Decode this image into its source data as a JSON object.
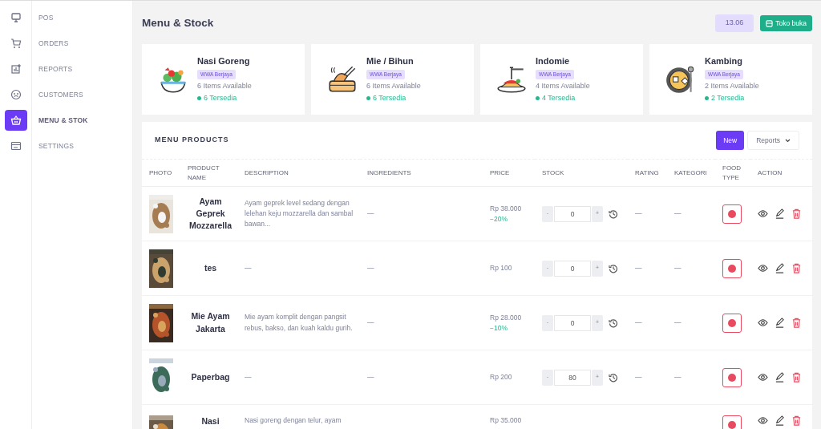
{
  "nav": [
    {
      "label": "POS",
      "selected": false
    },
    {
      "label": "ORDERS",
      "selected": false
    },
    {
      "label": "REPORTS",
      "selected": false
    },
    {
      "label": "CUSTOMERS",
      "selected": false
    },
    {
      "label": "MENU & STOK",
      "selected": true
    },
    {
      "label": "SETTINGS",
      "selected": false
    }
  ],
  "header": {
    "title": "Menu & Stock",
    "time": "13.06",
    "store_button": "Toko buka"
  },
  "categories": [
    {
      "name": "Nasi Goreng",
      "tag": "WWA Berjaya",
      "items": "6 Items Available",
      "available": "6 Tersedia"
    },
    {
      "name": "Mie / Bihun",
      "tag": "WWA Berjaya",
      "items": "6 Items Available",
      "available": "6 Tersedia"
    },
    {
      "name": "Indomie",
      "tag": "WWA Berjaya",
      "items": "4 Items Available",
      "available": "4 Tersedia"
    },
    {
      "name": "Kambing",
      "tag": "WWA Berjaya",
      "items": "2 Items Available",
      "available": "2 Tersedia"
    }
  ],
  "products": {
    "title": "MENU PRODUCTS",
    "new_button": "New",
    "reports_button": "Reports",
    "columns": [
      "PHOTO",
      "PRODUCT NAME",
      "DESCRIPTION",
      "INGREDIENTS",
      "PRICE",
      "STOCK",
      "RATING",
      "KATEGORI",
      "FOOD TYPE",
      "ACTION"
    ],
    "rows": [
      {
        "name": "Ayam Geprek Mozzarella",
        "description": "Ayam geprek level sedang dengan lelehan keju mozzarella dan sambal bawan...",
        "ingredients": "—",
        "price": "Rp 38.000",
        "discount": "−20%",
        "stock": "0",
        "minus": "-",
        "plus": "+",
        "rating": "—",
        "kategori": "—",
        "veg": false
      },
      {
        "name": "tes",
        "description": "—",
        "ingredients": "—",
        "price": "Rp 100",
        "stock": "0",
        "minus": "-",
        "plus": "+",
        "rating": "—",
        "kategori": "—",
        "veg": false
      },
      {
        "name": "Mie Ayam Jakarta",
        "description": "Mie ayam komplit dengan pangsit rebus, bakso, dan kuah kaldu gurih.",
        "ingredients": "—",
        "price": "Rp 28.000",
        "discount": "−10%",
        "stock": "0",
        "minus": "-",
        "plus": "+",
        "rating": "—",
        "kategori": "—",
        "veg": false
      },
      {
        "name": "Paperbag",
        "description": "—",
        "ingredients": "—",
        "price": "Rp 200",
        "stock": "80",
        "minus": "-",
        "plus": "+",
        "rating": "—",
        "kategori": "—",
        "veg": false
      },
      {
        "name": "Nasi",
        "description": "Nasi goreng dengan telur, ayam",
        "price": "Rp 35.000",
        "veg": false
      }
    ]
  }
}
